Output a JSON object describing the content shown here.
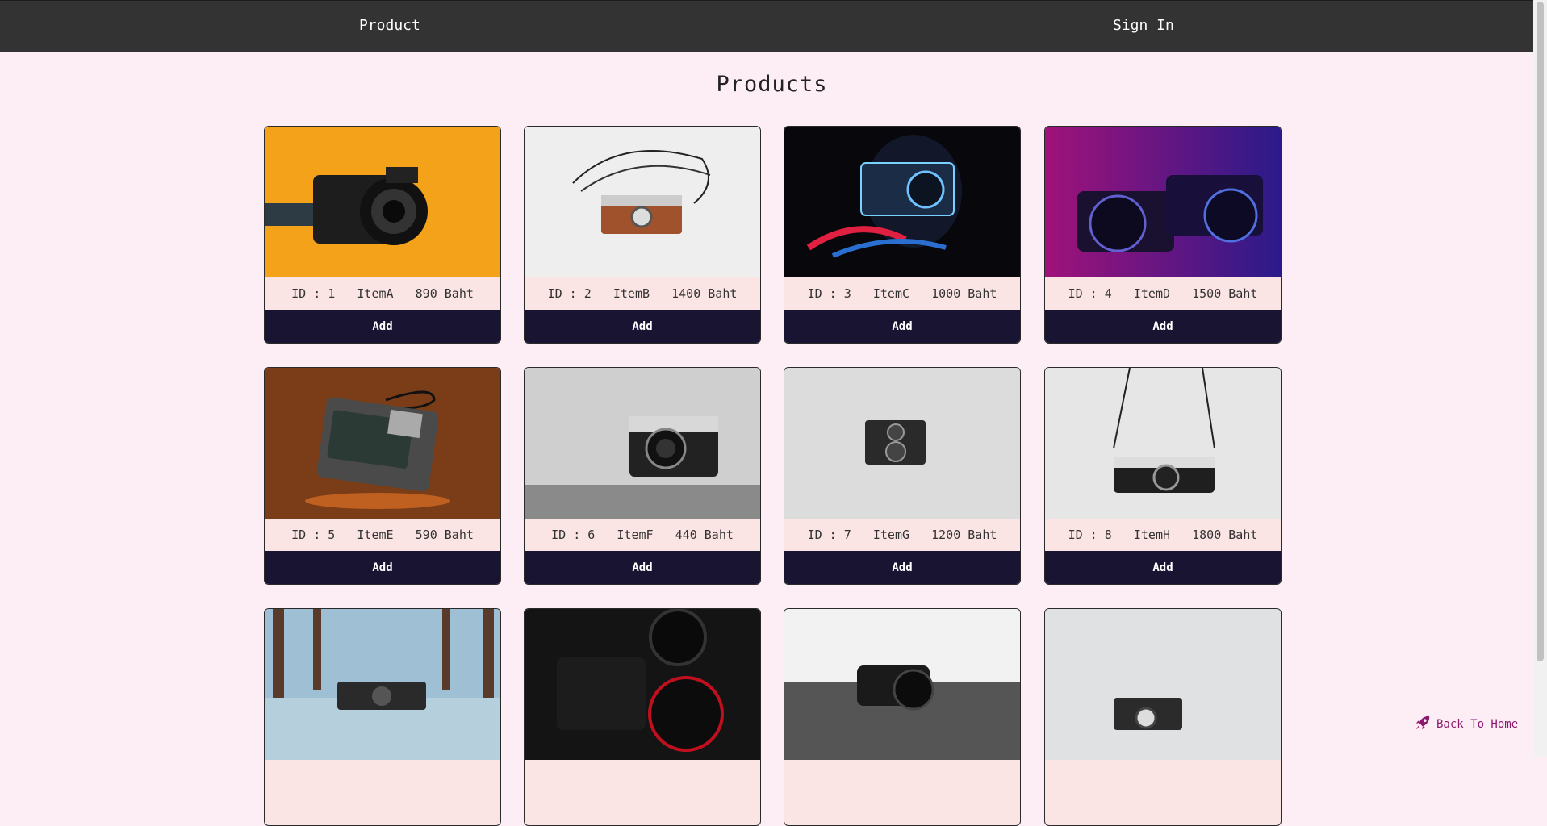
{
  "navbar": {
    "product_label": "Product",
    "signin_label": "Sign In"
  },
  "page": {
    "title": "Products"
  },
  "products": [
    {
      "id": "1",
      "name": "ItemA",
      "price": "890 Baht",
      "info": "ID : 1   ItemA   890 Baht",
      "add_label": "Add"
    },
    {
      "id": "2",
      "name": "ItemB",
      "price": "1400 Baht",
      "info": "ID : 2   ItemB   1400 Baht",
      "add_label": "Add"
    },
    {
      "id": "3",
      "name": "ItemC",
      "price": "1000 Baht",
      "info": "ID : 3   ItemC   1000 Baht",
      "add_label": "Add"
    },
    {
      "id": "4",
      "name": "ItemD",
      "price": "1500 Baht",
      "info": "ID : 4   ItemD   1500 Baht",
      "add_label": "Add"
    },
    {
      "id": "5",
      "name": "ItemE",
      "price": "590 Baht",
      "info": "ID : 5   ItemE   590 Baht",
      "add_label": "Add"
    },
    {
      "id": "6",
      "name": "ItemF",
      "price": "440 Baht",
      "info": "ID : 6   ItemF   440 Baht",
      "add_label": "Add"
    },
    {
      "id": "7",
      "name": "ItemG",
      "price": "1200 Baht",
      "info": "ID : 7   ItemG   1200 Baht",
      "add_label": "Add"
    },
    {
      "id": "8",
      "name": "ItemH",
      "price": "1800 Baht",
      "info": "ID : 8   ItemH   1800 Baht",
      "add_label": "Add"
    },
    {
      "info": ""
    },
    {
      "info": ""
    },
    {
      "info": ""
    },
    {
      "info": ""
    }
  ],
  "back_home": {
    "label": "Back To Home",
    "icon": "rocket-icon"
  },
  "colors": {
    "navbar": "#333333",
    "background": "#fdeef5",
    "button": "#1a1433",
    "info_bg": "#fbe4e4",
    "link": "#8b1a6e"
  }
}
